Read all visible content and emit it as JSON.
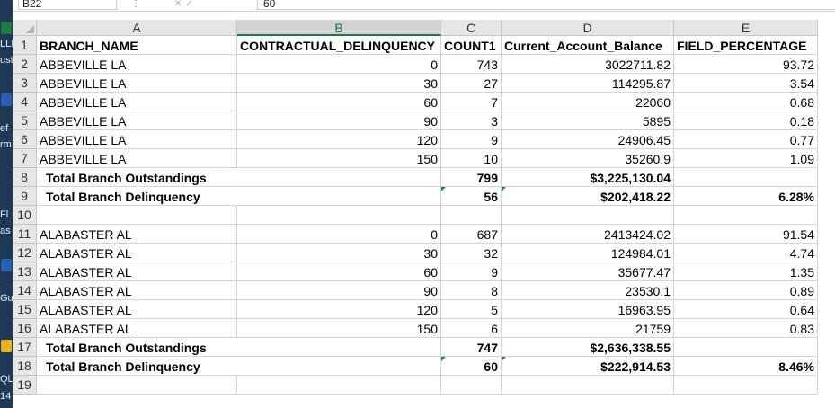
{
  "formula_bar": {
    "name_box": "B22",
    "formula": "60"
  },
  "desktop_fragments": [
    "LLI",
    "ust",
    "ef",
    "rm",
    "Fl",
    "as",
    "Gu",
    "QL",
    "14"
  ],
  "columns": [
    "A",
    "B",
    "C",
    "D",
    "E"
  ],
  "selected_column": "B",
  "rows": [
    {
      "num": "1",
      "cells": [
        "BRANCH_NAME",
        "CONTRACTUAL_DELINQUENCY",
        "COUNT1",
        "Current_Account_Balance",
        "FIELD_PERCENTAGE"
      ]
    },
    {
      "num": "2",
      "cells": [
        "ABBEVILLE LA",
        "0",
        "743",
        "3022711.82",
        "93.72"
      ]
    },
    {
      "num": "3",
      "cells": [
        "ABBEVILLE LA",
        "30",
        "27",
        "114295.87",
        "3.54"
      ]
    },
    {
      "num": "4",
      "cells": [
        "ABBEVILLE LA",
        "60",
        "7",
        "22060",
        "0.68"
      ]
    },
    {
      "num": "5",
      "cells": [
        "ABBEVILLE LA",
        "90",
        "3",
        "5895",
        "0.18"
      ]
    },
    {
      "num": "6",
      "cells": [
        "ABBEVILLE LA",
        "120",
        "9",
        "24906.45",
        "0.77"
      ]
    },
    {
      "num": "7",
      "cells": [
        "ABBEVILLE LA",
        "150",
        "10",
        "35260.9",
        "1.09"
      ]
    },
    {
      "num": "8",
      "cells": [
        "Total Branch Outstandings",
        "",
        "799",
        "$3,225,130.04",
        ""
      ]
    },
    {
      "num": "9",
      "cells": [
        "Total Branch Delinquency",
        "",
        "56",
        "$202,418.22",
        "6.28%"
      ]
    },
    {
      "num": "10",
      "cells": [
        "",
        "",
        "",
        "",
        ""
      ]
    },
    {
      "num": "11",
      "cells": [
        "ALABASTER AL",
        "0",
        "687",
        "2413424.02",
        "91.54"
      ]
    },
    {
      "num": "12",
      "cells": [
        "ALABASTER AL",
        "30",
        "32",
        "124984.01",
        "4.74"
      ]
    },
    {
      "num": "13",
      "cells": [
        "ALABASTER AL",
        "60",
        "9",
        "35677.47",
        "1.35"
      ]
    },
    {
      "num": "14",
      "cells": [
        "ALABASTER AL",
        "90",
        "8",
        "23530.1",
        "0.89"
      ]
    },
    {
      "num": "15",
      "cells": [
        "ALABASTER AL",
        "120",
        "5",
        "16963.95",
        "0.64"
      ]
    },
    {
      "num": "16",
      "cells": [
        "ALABASTER AL",
        "150",
        "6",
        "21759",
        "0.83"
      ]
    },
    {
      "num": "17",
      "cells": [
        "Total Branch Outstandings",
        "",
        "747",
        "$2,636,338.55",
        ""
      ]
    },
    {
      "num": "18",
      "cells": [
        "Total Branch Delinquency",
        "",
        "60",
        "$222,914.53",
        "8.46%"
      ]
    },
    {
      "num": "19",
      "cells": [
        "",
        "",
        "",
        "",
        ""
      ]
    }
  ]
}
